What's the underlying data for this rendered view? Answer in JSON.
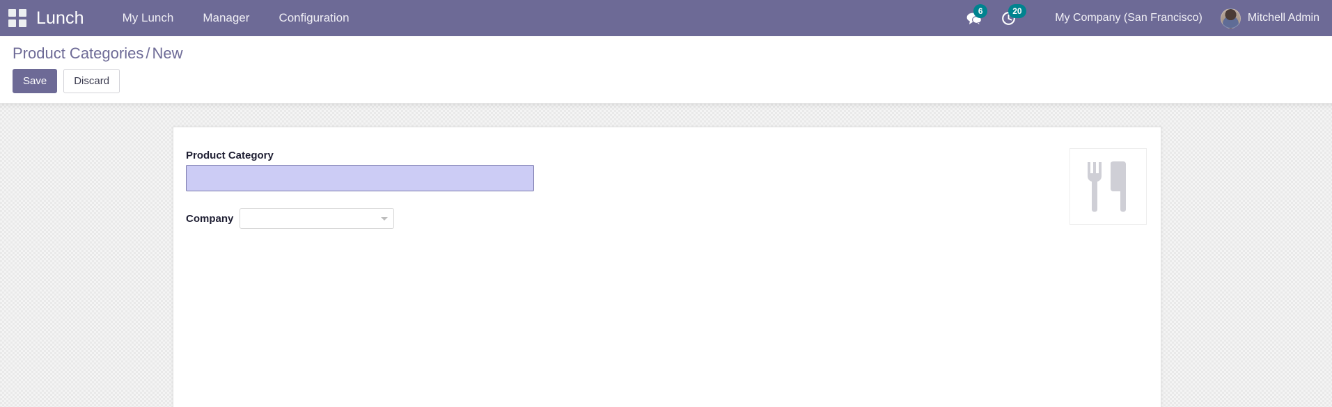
{
  "navbar": {
    "apps_icon": "apps-grid-icon",
    "brand": "Lunch",
    "menu": [
      {
        "label": "My Lunch",
        "name": "menu-my-lunch"
      },
      {
        "label": "Manager",
        "name": "menu-manager"
      },
      {
        "label": "Configuration",
        "name": "menu-configuration"
      }
    ],
    "messages": {
      "icon": "messages-icon",
      "count": "6"
    },
    "activities": {
      "icon": "activity-clock-icon",
      "count": "20"
    },
    "company": "My Company (San Francisco)",
    "user": "Mitchell Admin",
    "avatar_icon": "user-avatar",
    "background_color": "#6d6a96"
  },
  "control_panel": {
    "breadcrumb": {
      "parent": "Product Categories",
      "separator": "/",
      "current": "New"
    },
    "buttons": {
      "save": "Save",
      "discard": "Discard"
    },
    "accent_color": "#6d6a96"
  },
  "form": {
    "name_field": {
      "label": "Product Category",
      "value": "",
      "placeholder": "",
      "focused": true,
      "background_color": "#ccccf5",
      "border_color": "#7c7bad"
    },
    "company_field": {
      "label": "Company",
      "value": "",
      "placeholder": "",
      "caret_icon": "chevron-down-icon"
    },
    "image_placeholder": {
      "icon": "fork-and-knife-icon",
      "color": "#cfcfd6"
    }
  }
}
